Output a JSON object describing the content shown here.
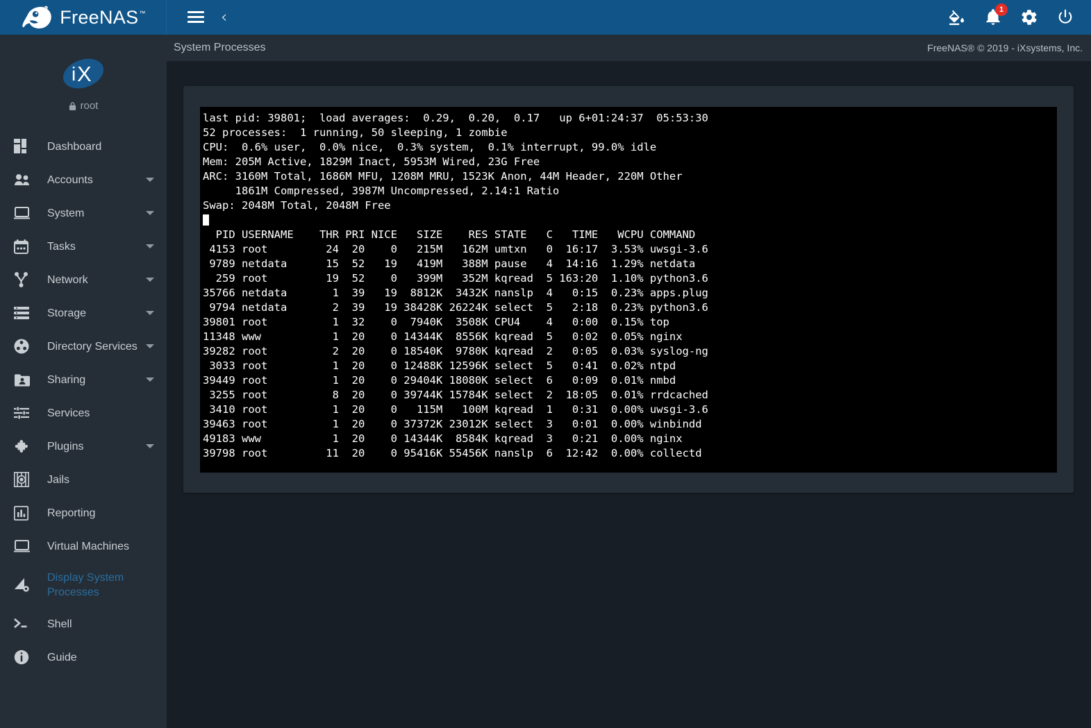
{
  "header": {
    "brand": "FreeNAS",
    "brand_tm": "™",
    "menu_icon": "hamburger-icon",
    "back_icon": "chevron-left-icon",
    "icons": [
      {
        "name": "theme-paint-icon",
        "label": "Change Theme"
      },
      {
        "name": "notifications-bell-icon",
        "label": "Alerts",
        "badge": "1"
      },
      {
        "name": "settings-gear-icon",
        "label": "Settings"
      },
      {
        "name": "power-icon",
        "label": "Power"
      }
    ]
  },
  "subheader": {
    "title": "System Processes",
    "copyright": "FreeNAS® © 2019 - iXsystems, Inc."
  },
  "sidebar": {
    "logo_text": "iX",
    "username": "root",
    "lock_icon": "lock-icon",
    "items": [
      {
        "label": "Dashboard",
        "icon": "dashboard-icon",
        "expandable": false,
        "active": false
      },
      {
        "label": "Accounts",
        "icon": "accounts-people-icon",
        "expandable": true,
        "active": false
      },
      {
        "label": "System",
        "icon": "system-monitor-icon",
        "expandable": true,
        "active": false
      },
      {
        "label": "Tasks",
        "icon": "tasks-calendar-icon",
        "expandable": true,
        "active": false
      },
      {
        "label": "Network",
        "icon": "network-icon",
        "expandable": true,
        "active": false
      },
      {
        "label": "Storage",
        "icon": "storage-disks-icon",
        "expandable": true,
        "active": false
      },
      {
        "label": "Directory Services",
        "icon": "directory-services-icon",
        "expandable": true,
        "active": false
      },
      {
        "label": "Sharing",
        "icon": "sharing-folder-icon",
        "expandable": true,
        "active": false
      },
      {
        "label": "Services",
        "icon": "services-sliders-icon",
        "expandable": false,
        "active": false
      },
      {
        "label": "Plugins",
        "icon": "plugins-puzzle-icon",
        "expandable": true,
        "active": false
      },
      {
        "label": "Jails",
        "icon": "jails-icon",
        "expandable": false,
        "active": false
      },
      {
        "label": "Reporting",
        "icon": "reporting-chart-icon",
        "expandable": false,
        "active": false
      },
      {
        "label": "Virtual Machines",
        "icon": "virtual-machines-icon",
        "expandable": false,
        "active": false
      },
      {
        "label": "Display System Processes",
        "icon": "system-processes-icon",
        "expandable": false,
        "active": true
      },
      {
        "label": "Shell",
        "icon": "shell-prompt-icon",
        "expandable": false,
        "active": false
      },
      {
        "label": "Guide",
        "icon": "guide-info-icon",
        "expandable": false,
        "active": false
      }
    ]
  },
  "terminal": {
    "summary_lines": [
      "last pid: 39801;  load averages:  0.29,  0.20,  0.17   up 6+01:24:37  05:53:30",
      "52 processes:  1 running, 50 sleeping, 1 zombie",
      "CPU:  0.6% user,  0.0% nice,  0.3% system,  0.1% interrupt, 99.0% idle",
      "Mem: 205M Active, 1829M Inact, 5953M Wired, 23G Free",
      "ARC: 3160M Total, 1686M MFU, 1208M MRU, 1523K Anon, 44M Header, 220M Other",
      "     1861M Compressed, 3987M Uncompressed, 2.14:1 Ratio",
      "Swap: 2048M Total, 2048M Free"
    ],
    "table_header": "  PID USERNAME    THR PRI NICE   SIZE    RES STATE   C   TIME   WCPU COMMAND",
    "rows": [
      " 4153 root         24  20    0   215M   162M umtxn   0  16:17  3.53% uwsgi-3.6",
      " 9789 netdata      15  52   19   419M   388M pause   4  14:16  1.29% netdata",
      "  259 root         19  52    0   399M   352M kqread  5 163:20  1.10% python3.6",
      "35766 netdata       1  39   19  8812K  3432K nanslp  4   0:15  0.23% apps.plug",
      " 9794 netdata       2  39   19 38428K 26224K select  5   2:18  0.23% python3.6",
      "39801 root          1  32    0  7940K  3508K CPU4    4   0:00  0.15% top",
      "11348 www           1  20    0 14344K  8556K kqread  5   0:02  0.05% nginx",
      "39282 root          2  20    0 18540K  9780K kqread  2   0:05  0.03% syslog-ng",
      " 3033 root          1  20    0 12488K 12596K select  5   0:41  0.02% ntpd",
      "39449 root          1  20    0 29404K 18080K select  6   0:09  0.01% nmbd",
      " 3255 root          8  20    0 39744K 15784K select  2  18:05  0.01% rrdcached",
      " 3410 root          1  20    0   115M   100M kqread  1   0:31  0.00% uwsgi-3.6",
      "39463 root          1  20    0 37372K 23012K select  3   0:01  0.00% winbindd",
      "49183 www           1  20    0 14344K  8584K kqread  3   0:21  0.00% nginx",
      "39798 root         11  20    0 95416K 55456K nanslp  6  12:42  0.00% collectd"
    ]
  },
  "colors": {
    "header_blue": "#105488",
    "sidebar_bg": "#252e37",
    "page_bg": "#171e26",
    "active_blue": "#2b6e9e",
    "badge_red": "#e52d27",
    "terminal_bg": "#000000",
    "terminal_fg": "#ffffff"
  }
}
